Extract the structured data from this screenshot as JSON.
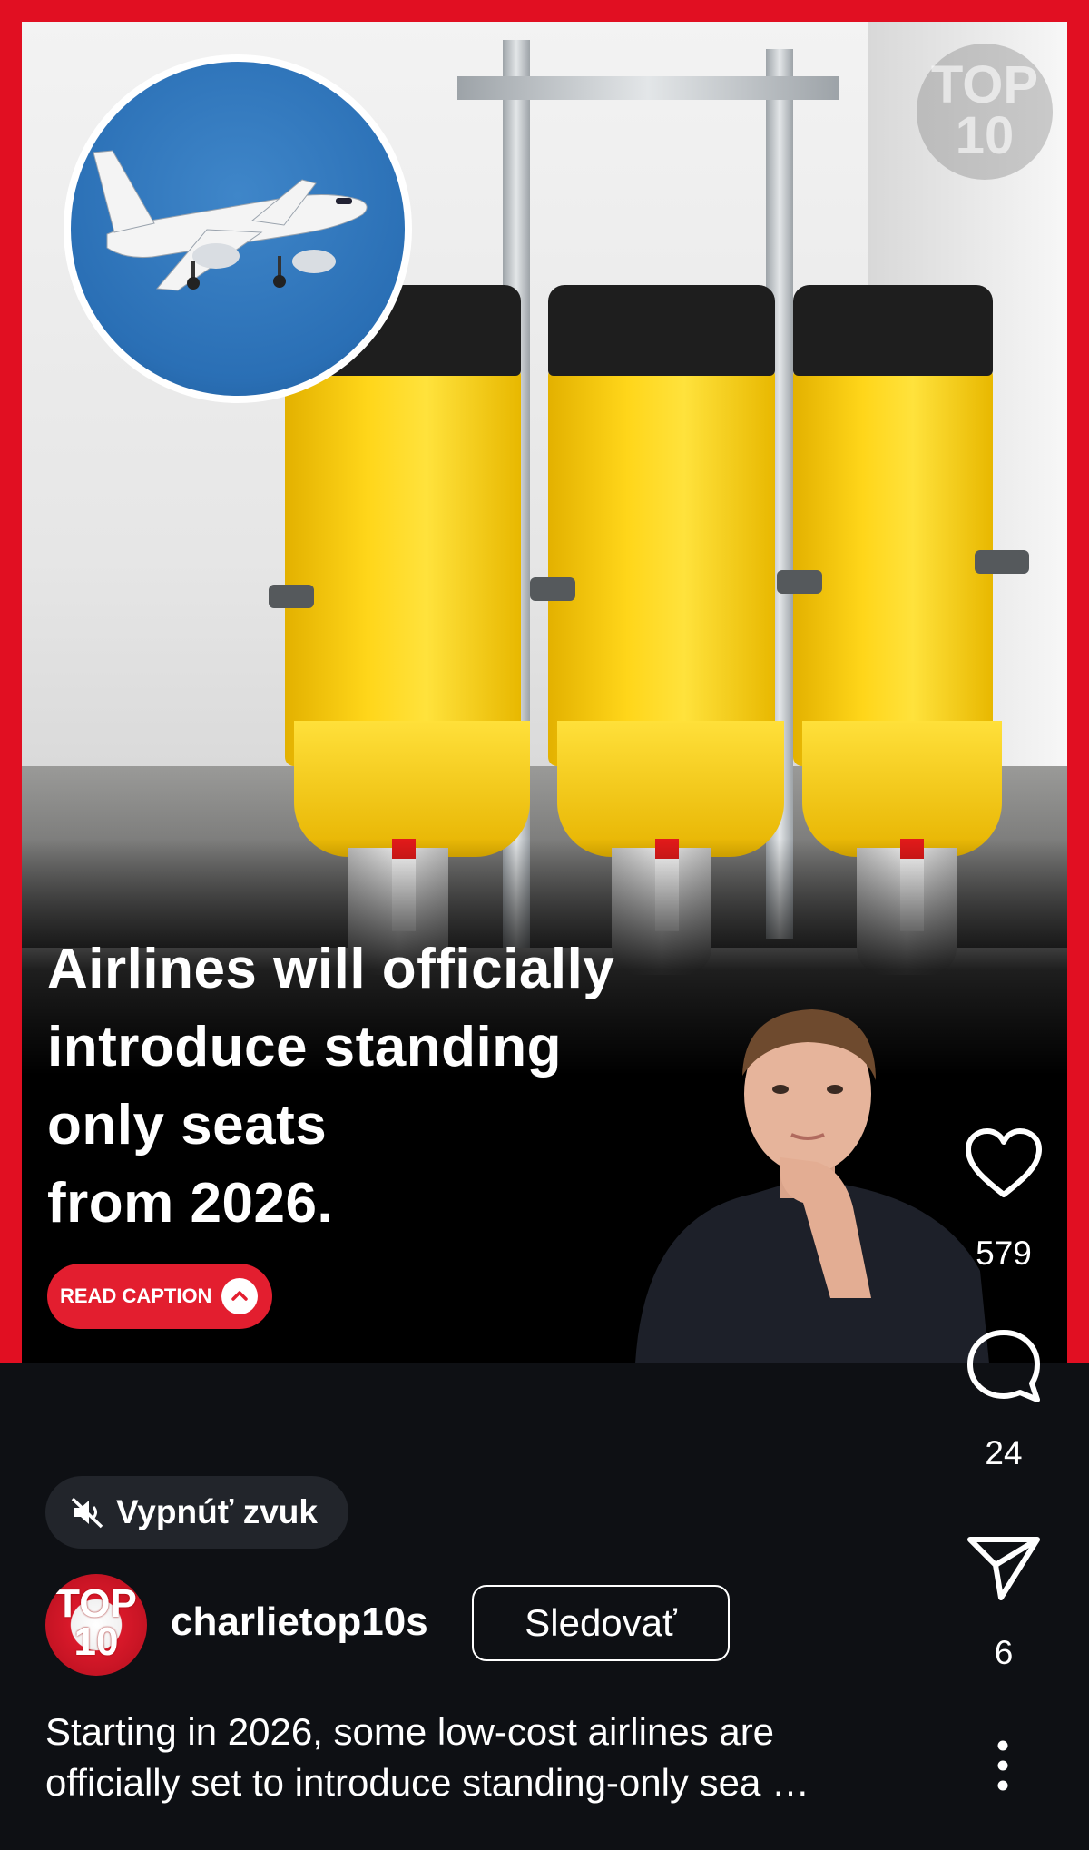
{
  "post": {
    "headline_lines": [
      "Airlines will officially",
      "introduce standing",
      "only seats",
      "from 2026."
    ],
    "read_caption_label": "READ CAPTION",
    "watermark_text": "TOP 10"
  },
  "actions": {
    "likes": "579",
    "comments": "24",
    "shares": "6"
  },
  "sound": {
    "label": "Vypnúť zvuk"
  },
  "account": {
    "username": "charlietop10s",
    "avatar_text": "TOP 10",
    "follow_label": "Sledovať"
  },
  "caption": {
    "line1": "Starting in 2026, some low-cost airlines are",
    "line2": "officially set to introduce standing-only sea …"
  },
  "colors": {
    "accent_red": "#e31e2f",
    "background": "#0e1014",
    "seat_yellow": "#ffd61a"
  },
  "icons": [
    "heart-icon",
    "comment-icon",
    "share-icon",
    "mute-icon",
    "chevron-up-icon",
    "more-icon"
  ]
}
